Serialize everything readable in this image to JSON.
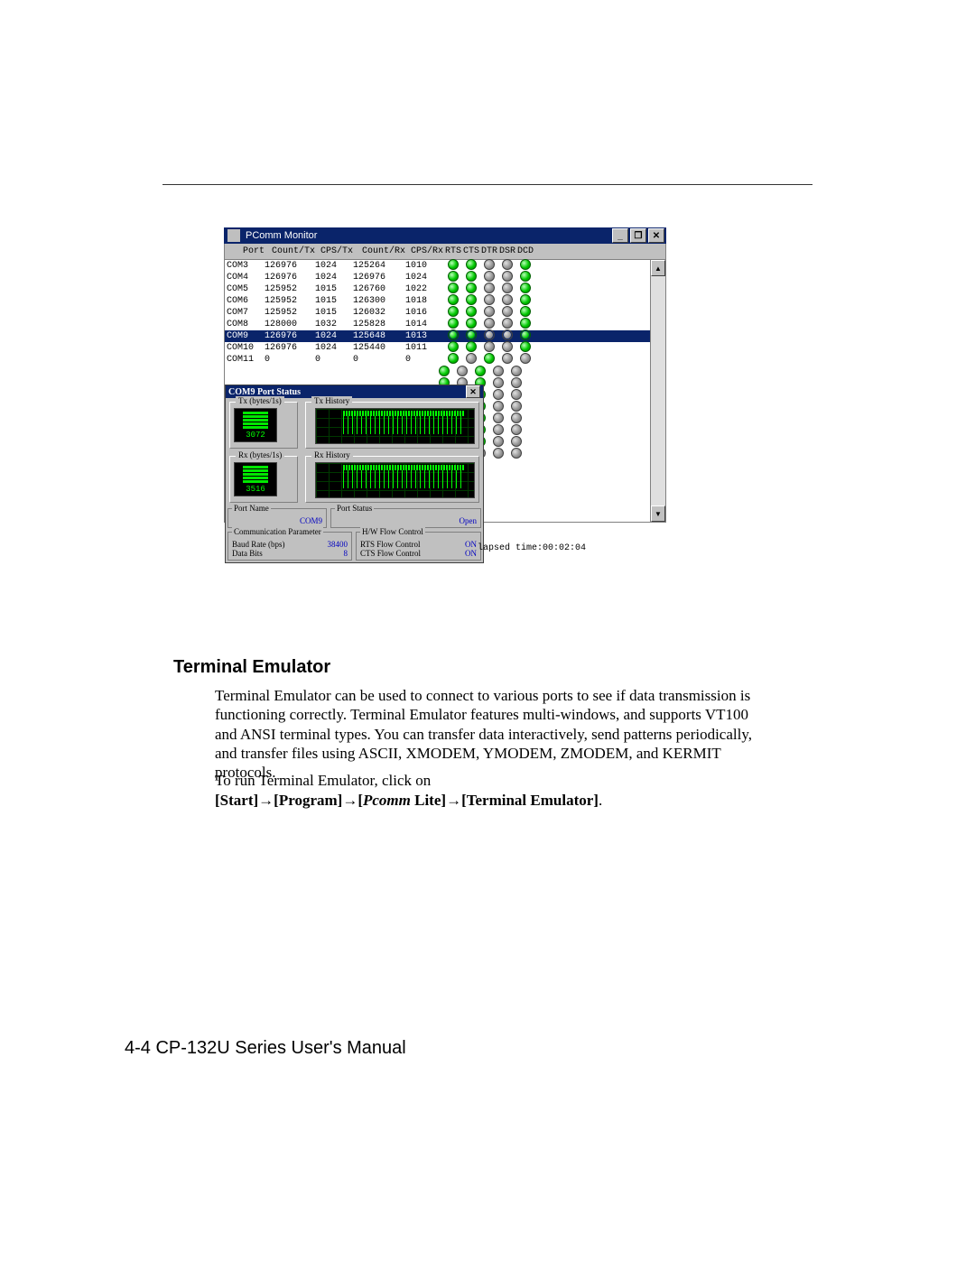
{
  "app_window": {
    "title": "PComm Monitor",
    "ctrl_min": "_",
    "ctrl_max": "❐",
    "ctrl_close": "✕"
  },
  "columns": {
    "port": "Port",
    "ctx": "Count/Tx",
    "cpstx": "CPS/Tx",
    "crx": "Count/Rx",
    "cpsrx": "CPS/Rx",
    "rts": "RTS",
    "cts": "CTS",
    "dtr": "DTR",
    "dsr": "DSR",
    "dcd": "DCD"
  },
  "ports": [
    {
      "name": "COM3",
      "ctx": "126976",
      "cpstx": "1024",
      "crx": "125264",
      "cpsrx": "1010",
      "rts": 1,
      "cts": 1,
      "dtr": 0,
      "dsr": 0,
      "dcd": 1,
      "sel": 0
    },
    {
      "name": "COM4",
      "ctx": "126976",
      "cpstx": "1024",
      "crx": "126976",
      "cpsrx": "1024",
      "rts": 1,
      "cts": 1,
      "dtr": 0,
      "dsr": 0,
      "dcd": 1,
      "sel": 0
    },
    {
      "name": "COM5",
      "ctx": "125952",
      "cpstx": "1015",
      "crx": "126760",
      "cpsrx": "1022",
      "rts": 1,
      "cts": 1,
      "dtr": 0,
      "dsr": 0,
      "dcd": 1,
      "sel": 0
    },
    {
      "name": "COM6",
      "ctx": "125952",
      "cpstx": "1015",
      "crx": "126300",
      "cpsrx": "1018",
      "rts": 1,
      "cts": 1,
      "dtr": 0,
      "dsr": 0,
      "dcd": 1,
      "sel": 0
    },
    {
      "name": "COM7",
      "ctx": "125952",
      "cpstx": "1015",
      "crx": "126032",
      "cpsrx": "1016",
      "rts": 1,
      "cts": 1,
      "dtr": 0,
      "dsr": 0,
      "dcd": 1,
      "sel": 0
    },
    {
      "name": "COM8",
      "ctx": "128000",
      "cpstx": "1032",
      "crx": "125828",
      "cpsrx": "1014",
      "rts": 1,
      "cts": 1,
      "dtr": 0,
      "dsr": 0,
      "dcd": 1,
      "sel": 0
    },
    {
      "name": "COM9",
      "ctx": "126976",
      "cpstx": "1024",
      "crx": "125648",
      "cpsrx": "1013",
      "rts": 1,
      "cts": 1,
      "dtr": 0,
      "dsr": 0,
      "dcd": 1,
      "sel": 1
    },
    {
      "name": "COM10",
      "ctx": "126976",
      "cpstx": "1024",
      "crx": "125440",
      "cpsrx": "1011",
      "rts": 1,
      "cts": 1,
      "dtr": 0,
      "dsr": 0,
      "dcd": 1,
      "sel": 0
    },
    {
      "name": "COM11",
      "ctx": "0",
      "cpstx": "0",
      "crx": "0",
      "cpsrx": "0",
      "rts": 1,
      "cts": 0,
      "dtr": 1,
      "dsr": 0,
      "dcd": 0,
      "sel": 0
    }
  ],
  "extra_leds": [
    [
      1,
      0,
      1,
      0,
      0
    ],
    [
      1,
      0,
      1,
      0,
      0
    ],
    [
      1,
      0,
      1,
      0,
      0
    ],
    [
      1,
      0,
      1,
      0,
      0
    ],
    [
      1,
      0,
      1,
      0,
      0
    ],
    [
      1,
      0,
      1,
      0,
      0
    ],
    [
      1,
      0,
      1,
      0,
      0
    ],
    [
      1,
      0,
      0,
      0,
      0
    ]
  ],
  "child": {
    "title": "COM9 Port Status",
    "close": "✕",
    "tx_group": "Tx (bytes/1s)",
    "tx_hist": "Tx History",
    "tx_val": "3072",
    "rx_group": "Rx (bytes/1s)",
    "rx_hist": "Rx History",
    "rx_val": "3516",
    "portname_lbl": "Port Name",
    "portname_val": "COM9",
    "portstatus_lbl": "Port Status",
    "portstatus_val": "Open",
    "comm_lbl": "Communication Parameter",
    "baud_lbl": "Baud Rate (bps)",
    "baud_val": "38400",
    "bits_lbl": "Data Bits",
    "bits_val": "8",
    "flow_lbl": "H/W Flow Control",
    "rts_lbl": "RTS Flow Control",
    "rts_val": "ON",
    "cts_lbl": "CTS Flow Control",
    "cts_val": "ON"
  },
  "elapsed": "lapsed time:00:02:04",
  "body": {
    "heading": "Terminal Emulator",
    "p1": "Terminal Emulator can be used to connect to various ports to see if data transmission is functioning correctly. Terminal Emulator features multi-windows, and supports VT100 and ANSI terminal types. You can transfer data interactively, send patterns periodically, and transfer files using ASCII, XMODEM, YMODEM, ZMODEM, and KERMIT protocols.",
    "p2a": "To run Terminal Emulator, click on",
    "nav_start": "[Start]",
    "nav_program": "[Program]",
    "nav_pcomm": "Pcomm",
    "nav_lite": " Lite]",
    "nav_term": "[Terminal Emulator]",
    "nav_open": "[",
    "arrow": "→",
    "period": "."
  },
  "footer": "4-4   CP-132U Series User's Manual"
}
